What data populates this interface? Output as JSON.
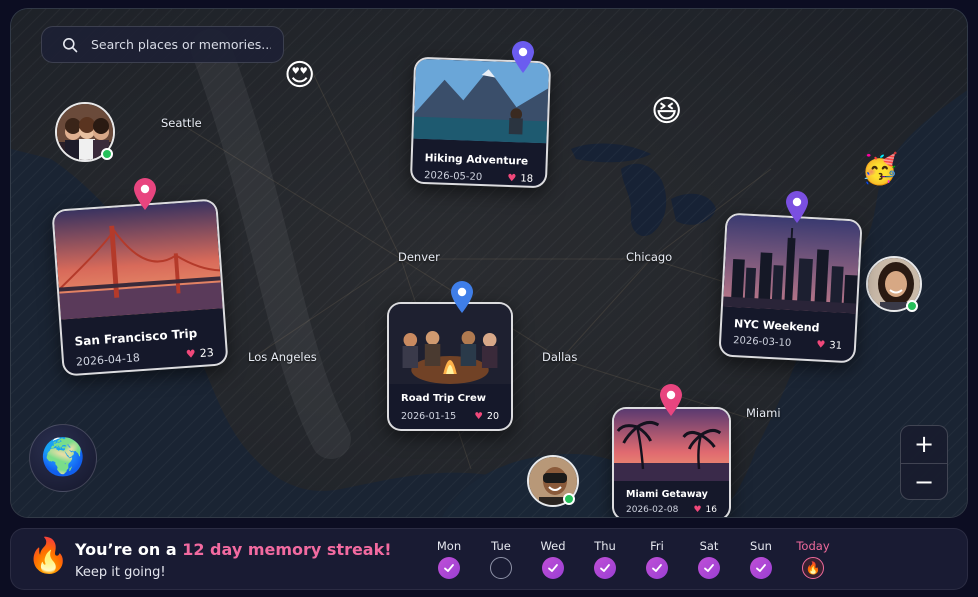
{
  "search": {
    "placeholder": "Search places or memories..."
  },
  "cities": [
    "Seattle",
    "Denver",
    "Chicago",
    "Los Angeles",
    "Dallas",
    "Miami"
  ],
  "memories": [
    {
      "title": "Hiking Adventure",
      "date": "2026-05-20",
      "likes": "18",
      "pin_color": "#6b5cf0"
    },
    {
      "title": "San Francisco Trip",
      "date": "2026-04-18",
      "likes": "23",
      "pin_color": "#e8457f"
    },
    {
      "title": "Road Trip Crew",
      "date": "2026-01-15",
      "likes": "20",
      "pin_color": "#3f7ee8"
    },
    {
      "title": "NYC Weekend",
      "date": "2026-03-10",
      "likes": "31",
      "pin_color": "#7a4fe0"
    },
    {
      "title": "Miami Getaway",
      "date": "2026-02-08",
      "likes": "16",
      "pin_color": "#e8457f"
    }
  ],
  "emojis": {
    "heart_eyes": "😍",
    "grin": "😆",
    "party": "🥳"
  },
  "controls": {
    "zoom_in": "+",
    "zoom_out": "−",
    "globe": "🌍"
  },
  "streak": {
    "icon": "🔥",
    "prefix": "You’re on a ",
    "highlight": "12 day memory streak!",
    "subtitle": "Keep it going!",
    "days": [
      {
        "label": "Mon",
        "state": "done"
      },
      {
        "label": "Tue",
        "state": "empty"
      },
      {
        "label": "Wed",
        "state": "done"
      },
      {
        "label": "Thu",
        "state": "done"
      },
      {
        "label": "Fri",
        "state": "done"
      },
      {
        "label": "Sat",
        "state": "done"
      },
      {
        "label": "Sun",
        "state": "done"
      },
      {
        "label": "Today",
        "state": "today"
      }
    ]
  },
  "colors": {
    "accent_pink": "#f06a9c",
    "accent_purple": "#a946d6",
    "online": "#26c05a",
    "background": "#0c0d22"
  }
}
